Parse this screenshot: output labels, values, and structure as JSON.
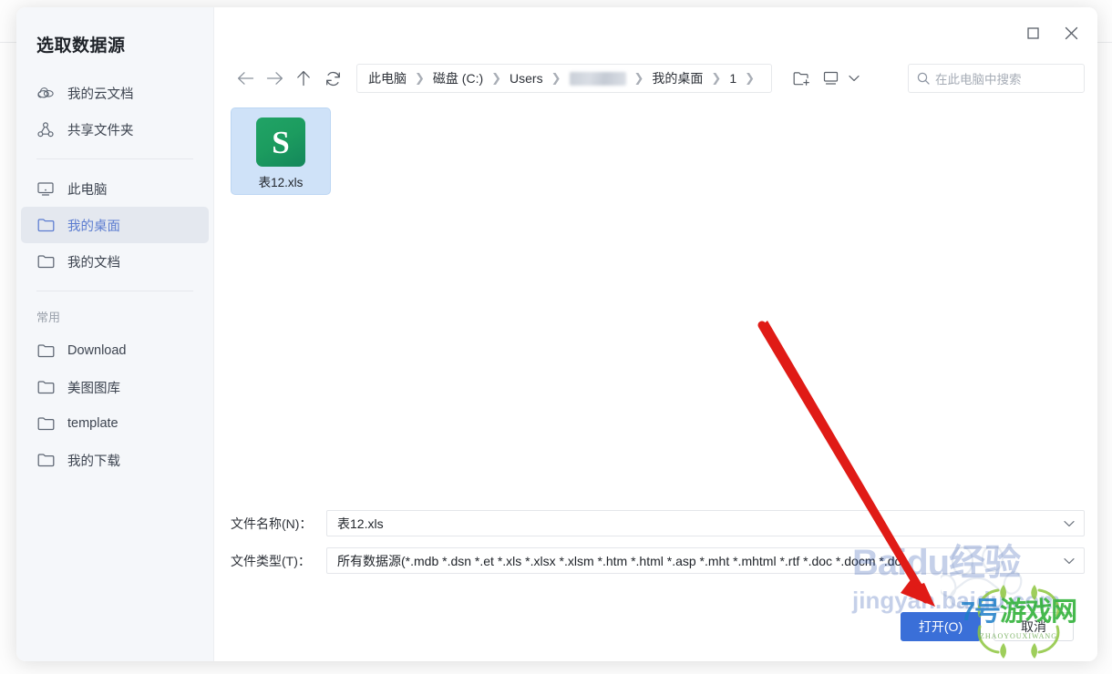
{
  "dialog": {
    "title": "选取数据源"
  },
  "window_controls": {
    "maximize_label": "□",
    "close_label": "✕"
  },
  "sidebar": {
    "items": [
      {
        "label": "我的云文档",
        "icon": "cloud-icon",
        "selected": false
      },
      {
        "label": "共享文件夹",
        "icon": "share-users-icon",
        "selected": false
      },
      {
        "label": "此电脑",
        "icon": "monitor-icon",
        "selected": false
      },
      {
        "label": "我的桌面",
        "icon": "folder-icon",
        "selected": true
      },
      {
        "label": "我的文档",
        "icon": "folder-icon",
        "selected": false
      }
    ],
    "group_label": "常用",
    "favorites": [
      {
        "label": "Download",
        "icon": "folder-icon"
      },
      {
        "label": "美图图库",
        "icon": "folder-icon"
      },
      {
        "label": "template",
        "icon": "folder-icon"
      },
      {
        "label": "我的下载",
        "icon": "folder-icon"
      }
    ]
  },
  "toolbar": {
    "back_icon": "arrow-left-icon",
    "forward_icon": "arrow-right-icon",
    "up_icon": "arrow-up-icon",
    "refresh_icon": "refresh-icon",
    "new_folder_icon": "new-folder-icon",
    "view_icon": "view-mode-icon",
    "view_chevron_icon": "chevron-down-icon",
    "breadcrumb": [
      {
        "label": "此电脑",
        "redacted": false
      },
      {
        "label": "磁盘 (C:)",
        "redacted": false
      },
      {
        "label": "Users",
        "redacted": false
      },
      {
        "label": "",
        "redacted": true
      },
      {
        "label": "我的桌面",
        "redacted": false
      },
      {
        "label": "1",
        "redacted": false
      }
    ],
    "breadcrumb_separator": "❯"
  },
  "search": {
    "icon": "search-icon",
    "placeholder": "在此电脑中搜索",
    "value": ""
  },
  "files": [
    {
      "name": "表12.xls",
      "icon_letter": "S",
      "icon_color": "#21a366",
      "selected": true
    }
  ],
  "form": {
    "filename_label": "文件名称(N)：",
    "filename_value": "表12.xls",
    "filetype_label": "文件类型(T)：",
    "filetype_value": "所有数据源(*.mdb *.dsn *.et *.xls *.xlsx *.xlsm *.htm *.html *.asp *.mht *.mhtml *.rtf *.doc *.docm *.do",
    "dropdown_icon": "chevron-down-icon"
  },
  "actions": {
    "open_label": "打开(O)",
    "cancel_label": "取消",
    "primary_color": "#3a6fd8"
  },
  "annotations": {
    "arrow_color": "#e01b16",
    "arrow_from": "836,357",
    "arrow_to": "1012,662"
  },
  "watermarks": {
    "baidu_top": "Baidu经验",
    "baidu_bottom": "jingyan.baidu.com",
    "game_text_prefix": "7号",
    "game_text_suffix": "游戏网",
    "game_subtitle": "ZHAOYOUXIWANG"
  }
}
